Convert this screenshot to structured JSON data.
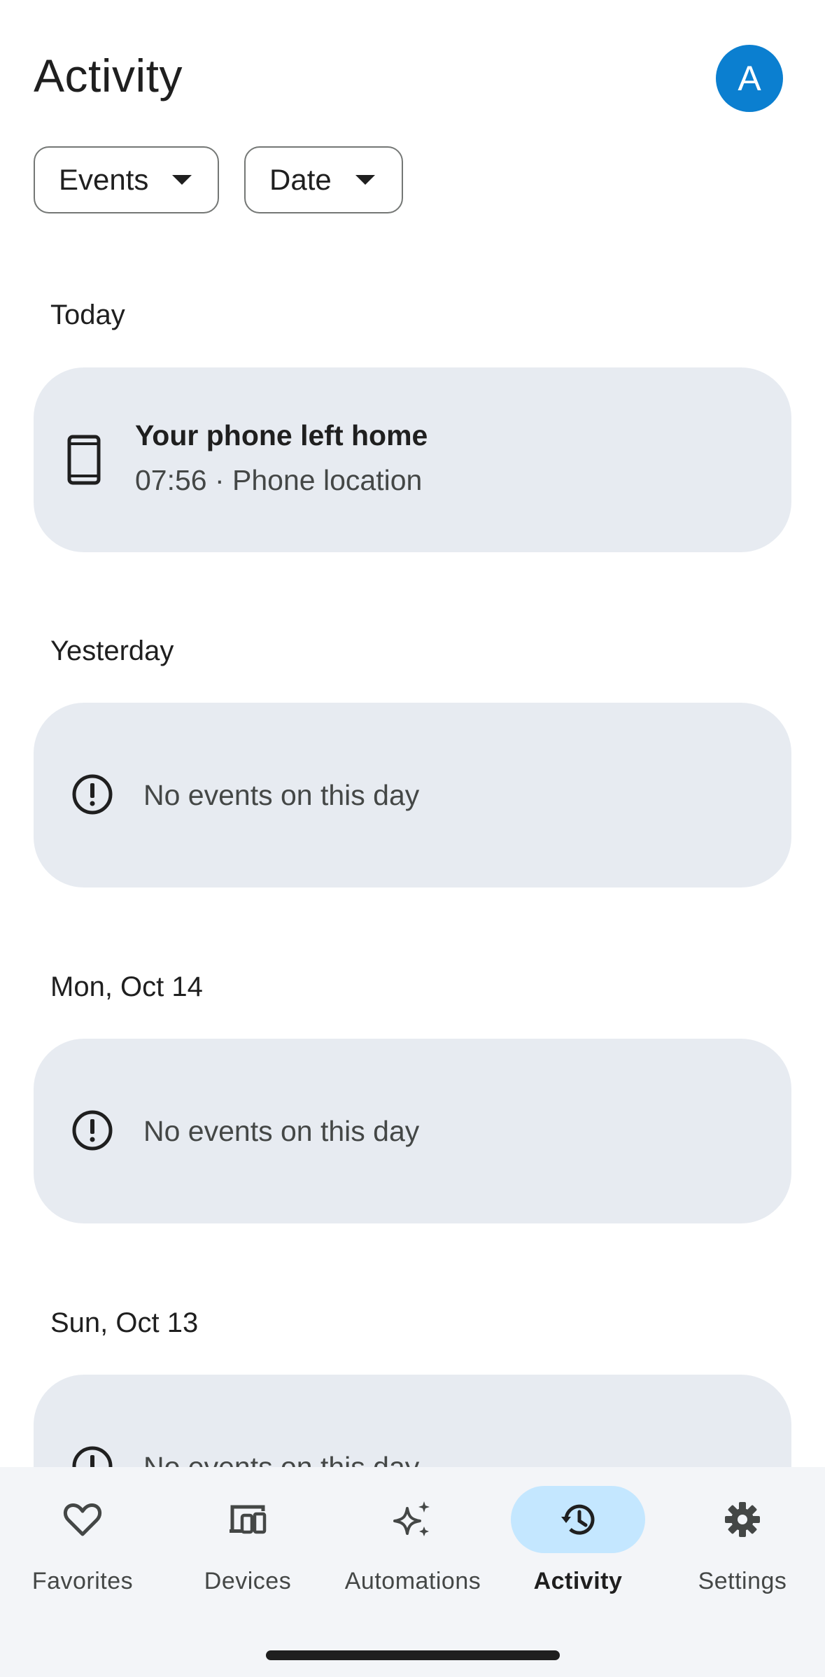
{
  "header": {
    "title": "Activity",
    "avatar_letter": "A",
    "avatar_color": "#0b7fd0"
  },
  "filters": {
    "events_label": "Events",
    "date_label": "Date"
  },
  "sections": [
    {
      "label": "Today",
      "event_title": "Your phone left home",
      "event_detail": "07:56 · Phone location",
      "icon": "smartphone-icon"
    },
    {
      "label": "Yesterday",
      "empty_text": "No events on this day",
      "icon": "alert-circle-icon"
    },
    {
      "label": "Mon, Oct 14",
      "empty_text": "No events on this day",
      "icon": "alert-circle-icon"
    },
    {
      "label": "Sun, Oct 13",
      "empty_text": "No events on this day",
      "icon": "alert-circle-icon"
    }
  ],
  "bottom_nav": {
    "items": [
      {
        "label": "Favorites",
        "icon": "heart-icon",
        "active": false
      },
      {
        "label": "Devices",
        "icon": "devices-icon",
        "active": false
      },
      {
        "label": "Automations",
        "icon": "sparkle-icon",
        "active": false
      },
      {
        "label": "Activity",
        "icon": "history-icon",
        "active": true
      },
      {
        "label": "Settings",
        "icon": "gear-icon",
        "active": false
      }
    ],
    "active_color": "#c4e7ff"
  }
}
